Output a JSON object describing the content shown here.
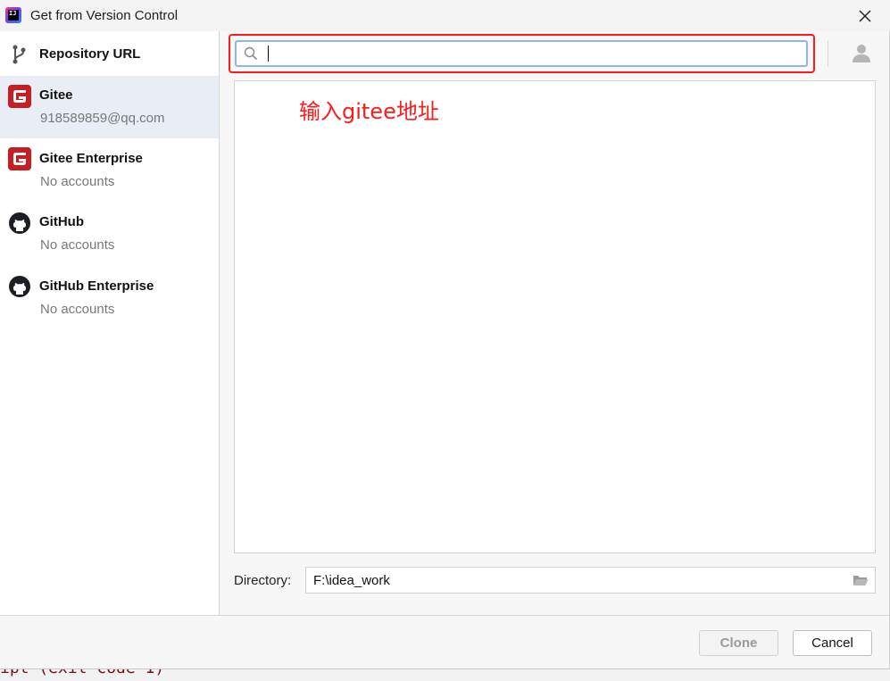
{
  "window": {
    "title": "Get from Version Control"
  },
  "sidebar": {
    "items": [
      {
        "label": "Repository URL",
        "sub": ""
      },
      {
        "label": "Gitee",
        "sub": "918589859@qq.com"
      },
      {
        "label": "Gitee Enterprise",
        "sub": "No accounts"
      },
      {
        "label": "GitHub",
        "sub": "No accounts"
      },
      {
        "label": "GitHub Enterprise",
        "sub": "No accounts"
      }
    ]
  },
  "search": {
    "value": "",
    "placeholder": ""
  },
  "annotation": "输入gitee地址",
  "directory": {
    "label": "Directory:",
    "value": "F:\\idea_work"
  },
  "buttons": {
    "clone": "Clone",
    "cancel": "Cancel"
  },
  "background_text": "ipt (exit code 1)",
  "colors": {
    "gitee": "#c71d23",
    "highlight": "#ff1a1a",
    "selected": "#e9eef6"
  }
}
